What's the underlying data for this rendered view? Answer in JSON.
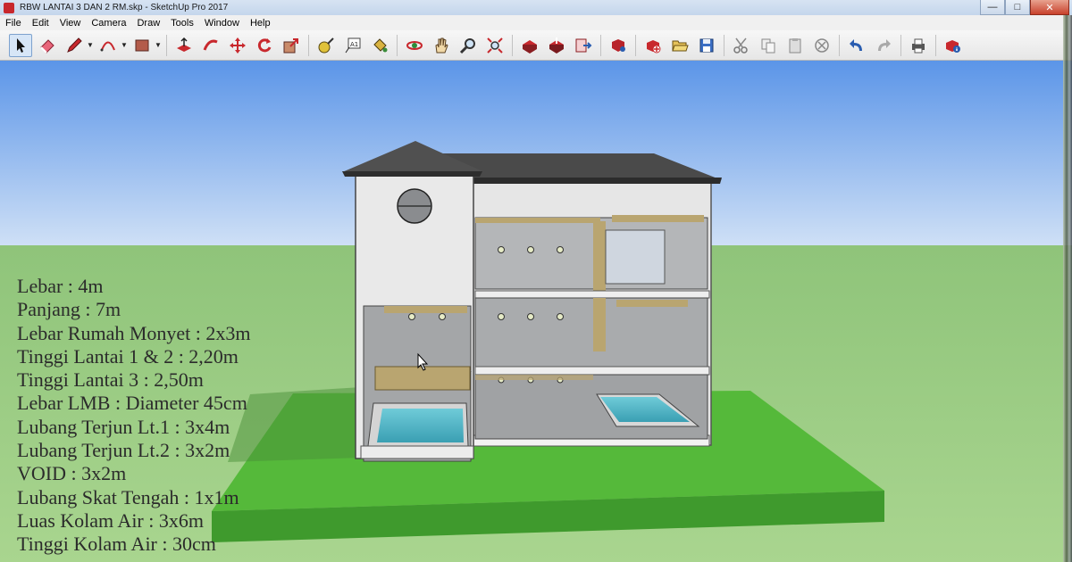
{
  "window": {
    "title": "RBW LANTAI 3 DAN 2 RM.skp - SketchUp Pro 2017",
    "controls": [
      "minimize",
      "maximize",
      "close"
    ]
  },
  "menu": [
    "File",
    "Edit",
    "View",
    "Camera",
    "Draw",
    "Tools",
    "Window",
    "Help"
  ],
  "toolbar": {
    "tools": [
      {
        "name": "select",
        "icon": "cursor-arrow-icon"
      },
      {
        "name": "eraser",
        "icon": "eraser-icon"
      },
      {
        "name": "line",
        "icon": "pencil-icon"
      },
      {
        "name": "arc",
        "icon": "arc-icon"
      },
      {
        "name": "rectangle",
        "icon": "rectangle-icon"
      },
      {
        "name": "push-pull",
        "icon": "push-pull-icon"
      },
      {
        "name": "follow-me",
        "icon": "follow-me-icon"
      },
      {
        "name": "move",
        "icon": "move-icon"
      },
      {
        "name": "rotate",
        "icon": "rotate-icon"
      },
      {
        "name": "scale",
        "icon": "scale-icon"
      },
      {
        "name": "tape-measure",
        "icon": "tape-measure-icon"
      },
      {
        "name": "text",
        "icon": "text-icon"
      },
      {
        "name": "paint-bucket",
        "icon": "paint-bucket-icon"
      },
      {
        "name": "orbit",
        "icon": "orbit-icon"
      },
      {
        "name": "pan",
        "icon": "pan-hand-icon"
      },
      {
        "name": "zoom",
        "icon": "zoom-icon"
      },
      {
        "name": "zoom-extents",
        "icon": "zoom-extents-icon"
      },
      {
        "name": "3d-warehouse",
        "icon": "warehouse-icon"
      },
      {
        "name": "share-model",
        "icon": "share-model-icon"
      },
      {
        "name": "send-to-layout",
        "icon": "layout-icon"
      },
      {
        "name": "extension-warehouse",
        "icon": "extension-icon"
      },
      {
        "name": "new",
        "icon": "new-file-icon"
      },
      {
        "name": "open",
        "icon": "open-folder-icon"
      },
      {
        "name": "save",
        "icon": "save-icon"
      },
      {
        "name": "cut",
        "icon": "scissors-icon"
      },
      {
        "name": "copy",
        "icon": "copy-icon"
      },
      {
        "name": "paste",
        "icon": "paste-icon"
      },
      {
        "name": "erase",
        "icon": "delete-circle-icon"
      },
      {
        "name": "undo",
        "icon": "undo-icon"
      },
      {
        "name": "redo",
        "icon": "redo-icon"
      },
      {
        "name": "print",
        "icon": "print-icon"
      },
      {
        "name": "model-info",
        "icon": "model-info-icon"
      }
    ]
  },
  "specs": [
    "Lebar : 4m",
    "Panjang : 7m",
    "Lebar Rumah Monyet : 2x3m",
    "Tinggi Lantai 1 & 2 : 2,20m",
    "Tinggi Lantai 3 : 2,50m",
    "Lebar LMB : Diameter 45cm",
    "Lubang Terjun Lt.1 : 3x4m",
    "Lubang Terjun Lt.2 : 3x2m",
    "VOID : 3x2m",
    "Lubang Skat Tengah : 1x1m",
    "Luas Kolam Air : 3x6m",
    "Tinggi Kolam Air : 30cm"
  ],
  "colors": {
    "sky_top": "#5b95e8",
    "sky_bottom": "#cfe0f6",
    "grass": "#8fc47a",
    "ground_block": "#55b93a",
    "roof": "#4a4a4a",
    "wall": "#e8e8e8",
    "interior": "#a8aaad",
    "water": "#4fb3c4",
    "wood": "#b9a570"
  }
}
